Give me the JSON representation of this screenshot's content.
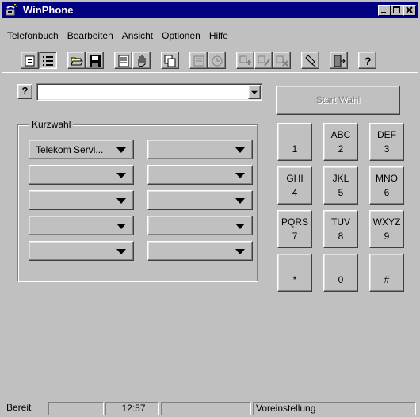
{
  "window": {
    "title": "WinPhone",
    "titlebar_color": "#000080",
    "controls": [
      "minimize-icon",
      "maximize-icon",
      "close-icon"
    ]
  },
  "menu": [
    {
      "label": "Telefonbuch"
    },
    {
      "label": "Bearbeiten"
    },
    {
      "label": "Ansicht"
    },
    {
      "label": "Optionen"
    },
    {
      "label": "Hilfe"
    }
  ],
  "toolbar": {
    "icons": [
      "card-view-icon",
      "list-view-icon",
      "open-folder-icon",
      "save-disk-icon",
      "phonebook-icon",
      "hand-icon",
      "copy-icon",
      "journal-icon",
      "clock-icon",
      "new-entry-icon",
      "edit-entry-icon",
      "delete-entry-icon",
      "settings-icon",
      "exit-door-icon",
      "help-question-icon"
    ]
  },
  "dial": {
    "help_label": "?",
    "number_value": "",
    "start_button": "Start Wahl"
  },
  "kurzwahl": {
    "title": "Kurzwahl",
    "buttons": [
      "Telekom Servi...",
      "",
      "",
      "",
      "",
      "",
      "",
      "",
      "",
      ""
    ]
  },
  "keypad": [
    {
      "top": "",
      "bottom": "1"
    },
    {
      "top": "ABC",
      "bottom": "2"
    },
    {
      "top": "DEF",
      "bottom": "3"
    },
    {
      "top": "GHI",
      "bottom": "4"
    },
    {
      "top": "JKL",
      "bottom": "5"
    },
    {
      "top": "MNO",
      "bottom": "6"
    },
    {
      "top": "PQRS",
      "bottom": "7"
    },
    {
      "top": "TUV",
      "bottom": "8"
    },
    {
      "top": "WXYZ",
      "bottom": "9"
    },
    {
      "top": "",
      "bottom": "*"
    },
    {
      "top": "",
      "bottom": "0"
    },
    {
      "top": "",
      "bottom": "#"
    }
  ],
  "status": {
    "state": "Bereit",
    "field2": "",
    "time": "12:57",
    "field4": "",
    "profile": "Voreinstellung"
  }
}
